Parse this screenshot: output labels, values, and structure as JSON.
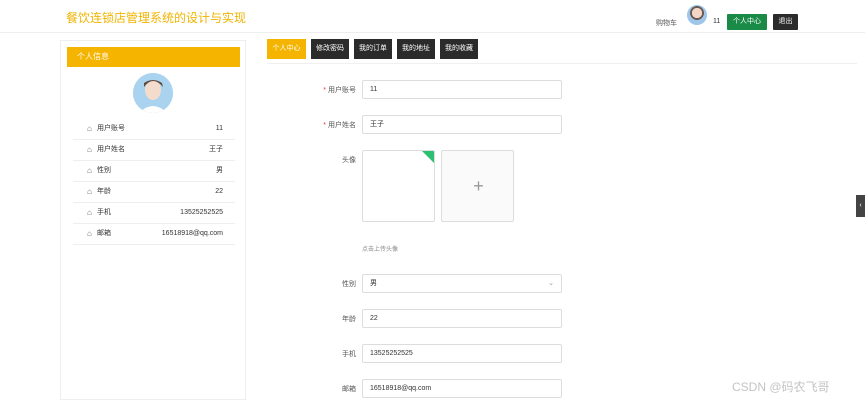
{
  "header": {
    "title": "餐饮连锁店管理系统的设计与实现",
    "cart_label": "购物车",
    "user_id": "11",
    "center_button": "个人中心",
    "logout_button": "退出"
  },
  "sidebar": {
    "heading": "个人信息",
    "rows": [
      {
        "label": "用户账号",
        "value": "11"
      },
      {
        "label": "用户姓名",
        "value": "王子"
      },
      {
        "label": "性别",
        "value": "男"
      },
      {
        "label": "年龄",
        "value": "22"
      },
      {
        "label": "手机",
        "value": "13525252525"
      },
      {
        "label": "邮箱",
        "value": "16518918@qq.com"
      }
    ]
  },
  "tabs": [
    "个人中心",
    "修改密码",
    "我的订单",
    "我的地址",
    "我的收藏"
  ],
  "form": {
    "account_label": "用户账号",
    "account_value": "11",
    "name_label": "用户姓名",
    "name_value": "王子",
    "avatar_label": "头像",
    "upload_hint": "点击上传头像",
    "gender_label": "性别",
    "gender_value": "男",
    "age_label": "年龄",
    "age_value": "22",
    "phone_label": "手机",
    "phone_value": "13525252525",
    "email_label": "邮箱",
    "email_value": "16518918@qq.com"
  },
  "watermark": "CSDN @码农飞哥",
  "colors": {
    "accent": "#f5b400",
    "primary_green": "#1a8a47",
    "dark": "#2b2b2b"
  }
}
